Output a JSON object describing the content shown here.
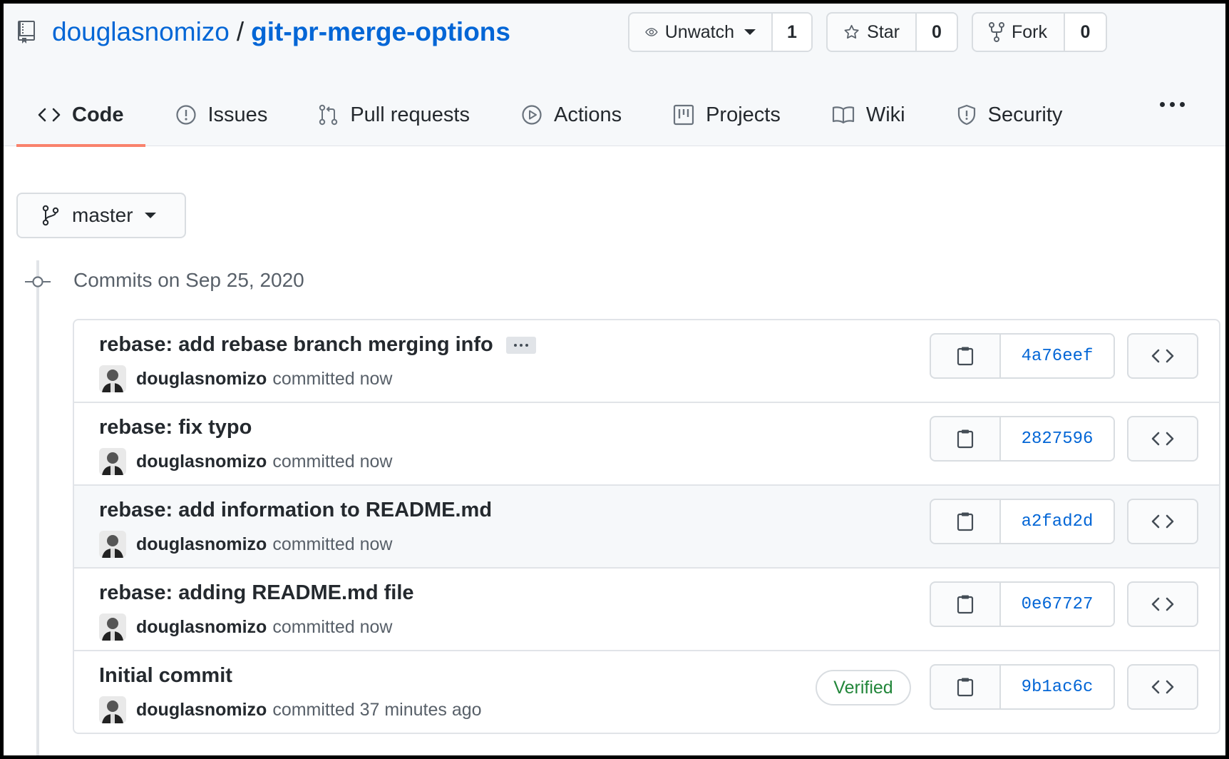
{
  "repo": {
    "owner": "douglasnomizo",
    "separator": "/",
    "name": "git-pr-merge-options"
  },
  "social": {
    "watch_label": "Unwatch",
    "watch_count": "1",
    "star_label": "Star",
    "star_count": "0",
    "fork_label": "Fork",
    "fork_count": "0"
  },
  "tabs": [
    {
      "label": "Code",
      "icon": "code-icon",
      "selected": true
    },
    {
      "label": "Issues",
      "icon": "issue-icon"
    },
    {
      "label": "Pull requests",
      "icon": "pull-request-icon"
    },
    {
      "label": "Actions",
      "icon": "play-icon"
    },
    {
      "label": "Projects",
      "icon": "project-icon"
    },
    {
      "label": "Wiki",
      "icon": "book-icon"
    },
    {
      "label": "Security",
      "icon": "shield-icon"
    }
  ],
  "branch": {
    "name": "master"
  },
  "commits_header": "Commits on Sep 25, 2020",
  "commits": [
    {
      "message": "rebase: add rebase branch merging info",
      "author": "douglasnomizo",
      "when": "committed now",
      "sha": "4a76eef",
      "has_ellipsis": true
    },
    {
      "message": "rebase: fix typo",
      "author": "douglasnomizo",
      "when": "committed now",
      "sha": "2827596"
    },
    {
      "message": "rebase: add information to README.md",
      "author": "douglasnomizo",
      "when": "committed now",
      "sha": "a2fad2d",
      "highlighted": true
    },
    {
      "message": "rebase: adding README.md file",
      "author": "douglasnomizo",
      "when": "committed now",
      "sha": "0e67727"
    },
    {
      "message": "Initial commit",
      "author": "douglasnomizo",
      "when": "committed 37 minutes ago",
      "sha": "9b1ac6c",
      "verified": "Verified"
    }
  ],
  "colors": {
    "link": "#0366d6",
    "tab_underline": "#f9826c",
    "verified": "#22863a"
  }
}
